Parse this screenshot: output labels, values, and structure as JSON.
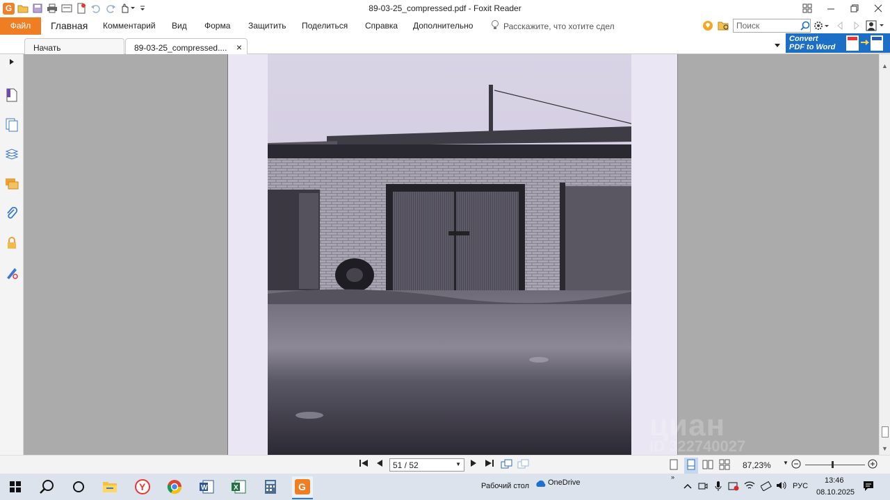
{
  "window": {
    "title": "89-03-25_compressed.pdf - Foxit Reader"
  },
  "ribbon": {
    "tabs": [
      "Файл",
      "Главная",
      "Комментарий",
      "Вид",
      "Форма",
      "Защитить",
      "Поделиться",
      "Справка",
      "Дополнительно"
    ],
    "tell_me": "Расскажите, что хотите сдел",
    "search_placeholder": "Поиск"
  },
  "doc_tabs": {
    "start": "Начать",
    "current": "89-03-25_compressed...."
  },
  "convert_banner": {
    "line1": "Convert",
    "line2": "PDF to Word"
  },
  "document": {
    "watermark_brand": "циан",
    "watermark_id": "ID 322740027"
  },
  "statusbar": {
    "page_field": "51 / 52",
    "current_page": 51,
    "total_pages": 52,
    "zoom": "87,23%",
    "zoom_level": 0.45
  },
  "taskbar": {
    "desktop_label": "Рабочий стол",
    "onedrive_label": "OneDrive",
    "language": "РУС",
    "time": "13:46",
    "date": "08.10.2025"
  },
  "colors": {
    "foxit_orange": "#ef7d22",
    "convert_blue": "#1b6fc6",
    "doc_bg": "#ababab"
  }
}
